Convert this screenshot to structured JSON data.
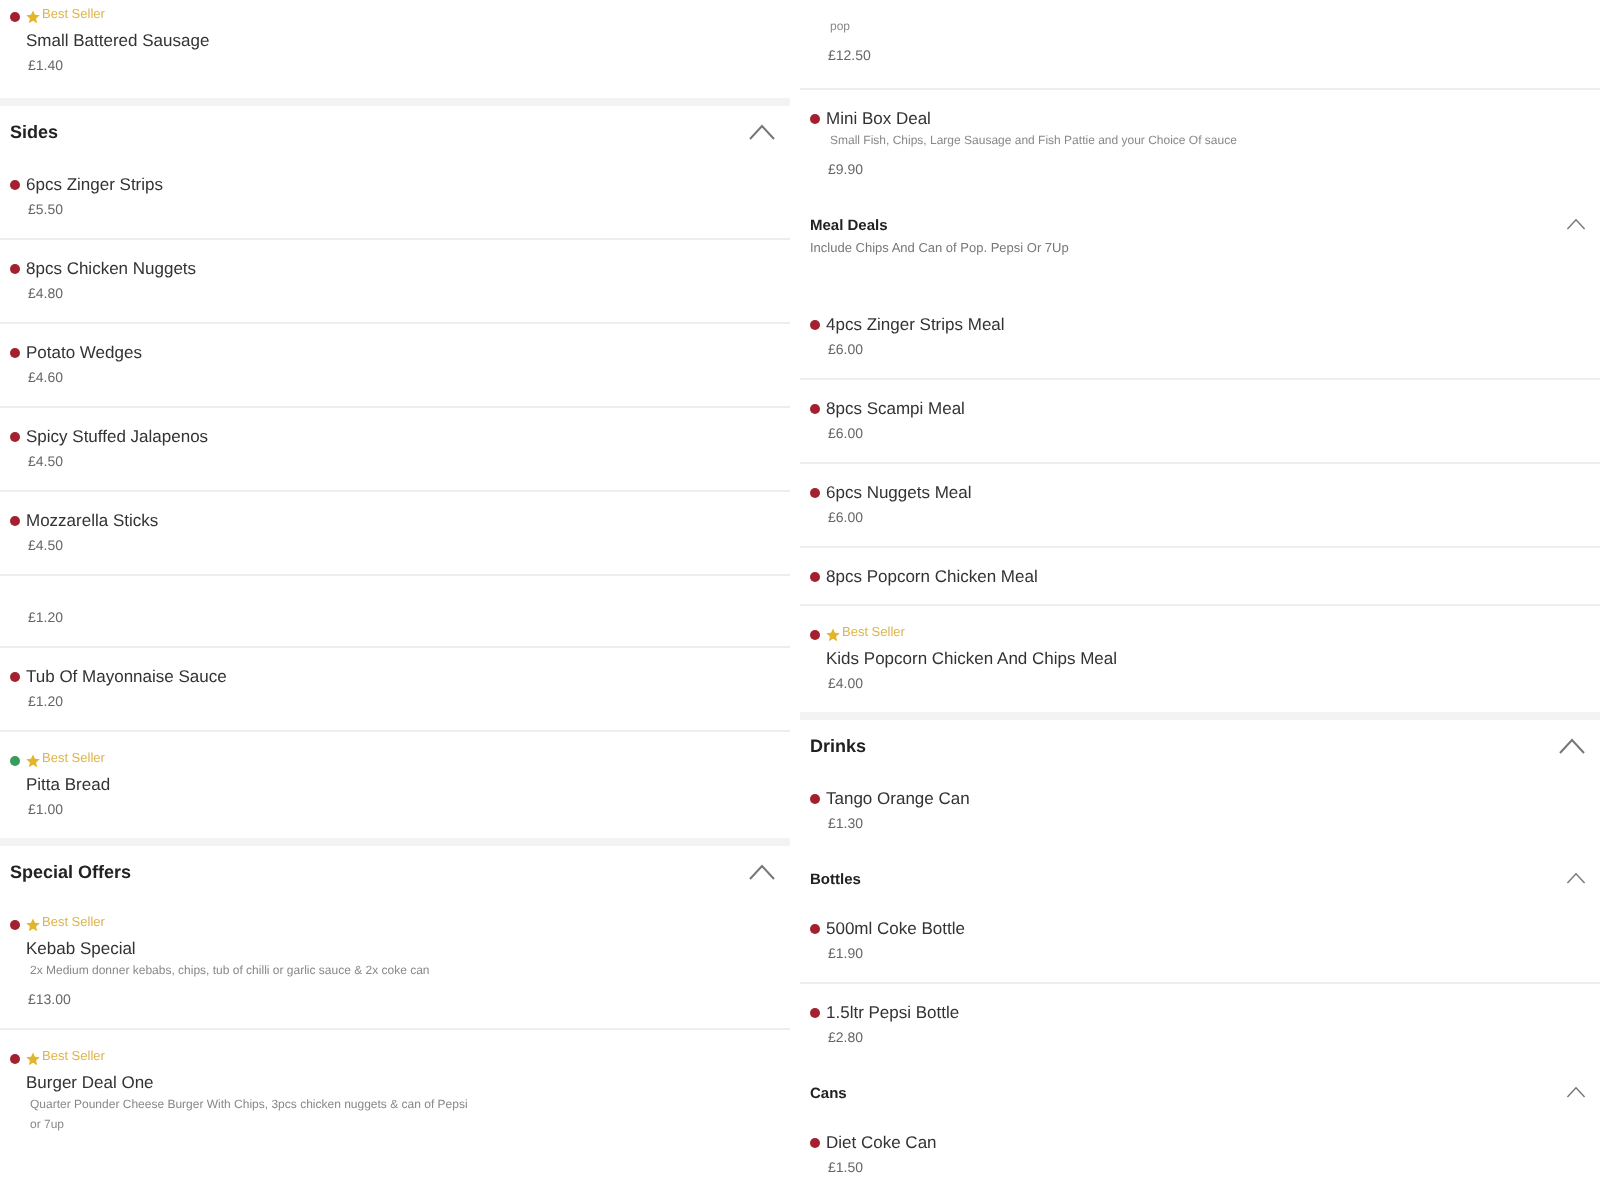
{
  "columns": [
    {
      "blocks": [
        {
          "kind": "item",
          "color": "#a3202f",
          "best_seller": true,
          "badge": "Best Seller",
          "name": "Small Battered Sausage",
          "price": "£1.40"
        },
        {
          "kind": "section",
          "title": "Sides",
          "expanded": true
        },
        {
          "kind": "item",
          "color": "#a3202f",
          "best_seller": false,
          "name": "6pcs Zinger Strips",
          "price": "£5.50"
        },
        {
          "kind": "item",
          "color": "#a3202f",
          "best_seller": false,
          "name": "8pcs Chicken Nuggets",
          "price": "£4.80"
        },
        {
          "kind": "item",
          "color": "#a3202f",
          "best_seller": false,
          "name": "Potato Wedges",
          "price": "£4.60"
        },
        {
          "kind": "item",
          "color": "#a3202f",
          "best_seller": false,
          "name": "Spicy Stuffed Jalapenos",
          "price": "£4.50"
        },
        {
          "kind": "item",
          "color": "#a3202f",
          "best_seller": false,
          "name": "Mozzarella Sticks",
          "price": "£4.50"
        },
        {
          "kind": "item",
          "best_seller": false,
          "price": "£1.20"
        },
        {
          "kind": "item",
          "color": "#a3202f",
          "best_seller": false,
          "name": "Tub Of Mayonnaise Sauce",
          "price": "£1.20"
        },
        {
          "kind": "item",
          "color": "#3a9c5a",
          "best_seller": true,
          "badge": "Best Seller",
          "name": "Pitta Bread",
          "price": "£1.00"
        },
        {
          "kind": "section",
          "title": "Special Offers",
          "expanded": true
        },
        {
          "kind": "item",
          "color": "#a3202f",
          "best_seller": true,
          "badge": "Best Seller",
          "name": "Kebab Special",
          "description": "2x Medium donner kebabs, chips, tub of chilli or garlic sauce & 2x coke can",
          "price": "£13.00"
        },
        {
          "kind": "item",
          "color": "#a3202f",
          "best_seller": true,
          "badge": "Best Seller",
          "name": "Burger Deal One",
          "description": "Quarter Pounder Cheese Burger With Chips, 3pcs chicken nuggets & can of Pepsi or 7up"
        }
      ]
    },
    {
      "blocks": [
        {
          "kind": "item",
          "best_seller": false,
          "description": "pop",
          "price": "£12.50"
        },
        {
          "kind": "item",
          "color": "#a3202f",
          "best_seller": false,
          "name": "Mini Box Deal",
          "description": "Small Fish, Chips, Large Sausage and Fish Pattie and your Choice Of sauce",
          "price": "£9.90"
        },
        {
          "kind": "subsection",
          "title": "Meal Deals",
          "subtitle": "Include Chips And Can of Pop. Pepsi Or 7Up",
          "expanded": true
        },
        {
          "kind": "item",
          "color": "#a3202f",
          "best_seller": false,
          "name": "4pcs Zinger Strips Meal",
          "price": "£6.00"
        },
        {
          "kind": "item",
          "color": "#a3202f",
          "best_seller": false,
          "name": "8pcs Scampi Meal",
          "price": "£6.00"
        },
        {
          "kind": "item",
          "color": "#a3202f",
          "best_seller": false,
          "name": "6pcs Nuggets Meal",
          "price": "£6.00"
        },
        {
          "kind": "item",
          "color": "#a3202f",
          "best_seller": false,
          "name": "8pcs Popcorn Chicken Meal"
        },
        {
          "kind": "item",
          "color": "#a3202f",
          "best_seller": true,
          "badge": "Best Seller",
          "name": "Kids Popcorn Chicken And Chips Meal",
          "price": "£4.00"
        },
        {
          "kind": "section",
          "title": "Drinks",
          "expanded": true
        },
        {
          "kind": "item",
          "color": "#a3202f",
          "best_seller": false,
          "name": "Tango Orange Can",
          "price": "£1.30"
        },
        {
          "kind": "subsection",
          "title": "Bottles",
          "expanded": true
        },
        {
          "kind": "item",
          "color": "#a3202f",
          "best_seller": false,
          "name": "500ml Coke Bottle",
          "price": "£1.90"
        },
        {
          "kind": "item",
          "color": "#a3202f",
          "best_seller": false,
          "name": "1.5ltr Pepsi Bottle",
          "price": "£2.80"
        },
        {
          "kind": "subsection",
          "title": "Cans",
          "expanded": true
        },
        {
          "kind": "item",
          "color": "#a3202f",
          "best_seller": false,
          "name": "Diet Coke Can",
          "price": "£1.50"
        }
      ]
    }
  ]
}
